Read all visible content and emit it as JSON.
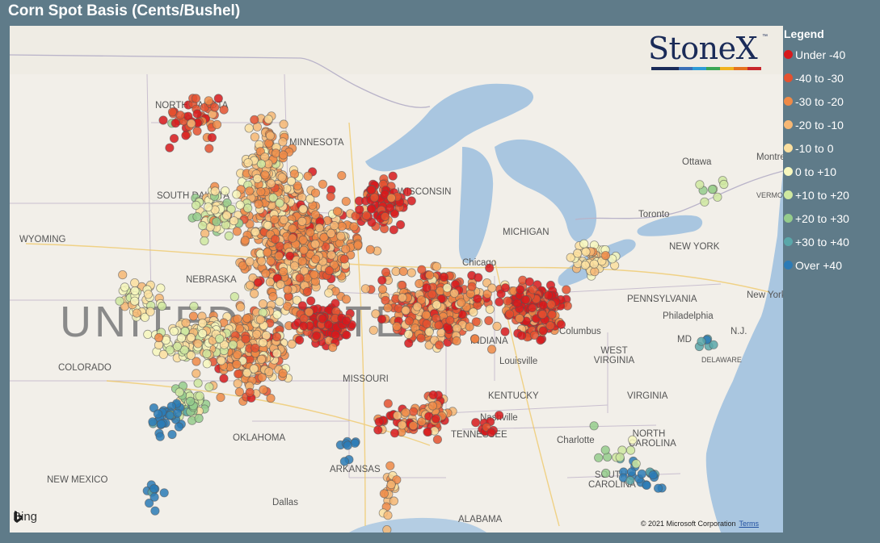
{
  "title": "Corn Spot Basis (Cents/Bushel)",
  "legend": {
    "title": "Legend",
    "items": [
      {
        "label": "Under -40",
        "color": "#d7191c"
      },
      {
        "label": "-40 to -30",
        "color": "#e4512f"
      },
      {
        "label": "-30 to -20",
        "color": "#ef8a47"
      },
      {
        "label": "-20 to -10",
        "color": "#f6b774"
      },
      {
        "label": "-10 to 0",
        "color": "#fbdf9f"
      },
      {
        "label": "0 to +10",
        "color": "#f7f7bd"
      },
      {
        "label": "+10 to +20",
        "color": "#cfe8a0"
      },
      {
        "label": "+20 to +30",
        "color": "#95cc8c"
      },
      {
        "label": "+30 to +40",
        "color": "#5aa7a9"
      },
      {
        "label": "Over +40",
        "color": "#2c7bb6"
      }
    ]
  },
  "logo": {
    "text": "StoneX",
    "tm": "™",
    "bar_colors": [
      "#1a2b58",
      "#1a2b58",
      "#3b6fb6",
      "#2e9bd6",
      "#3aa655",
      "#f0b21e",
      "#e5721f",
      "#c8262b"
    ]
  },
  "attribution": {
    "bing": "Bing",
    "copyright": "© 2021 Microsoft Corporation",
    "terms": "Terms"
  },
  "map_labels": [
    {
      "text": "NORTH DAKOTA"
    },
    {
      "text": "SOUTH DAKOTA"
    },
    {
      "text": "MINNESOTA"
    },
    {
      "text": "WISCONSIN"
    },
    {
      "text": "WYOMING"
    },
    {
      "text": "NEBRASKA"
    },
    {
      "text": "COLORADO"
    },
    {
      "text": "UNITED STATES"
    },
    {
      "text": "MICHIGAN"
    },
    {
      "text": "Chicago"
    },
    {
      "text": "MISSOURI"
    },
    {
      "text": "INDIANA"
    },
    {
      "text": "Columbus"
    },
    {
      "text": "Louisville"
    },
    {
      "text": "KENTUCKY"
    },
    {
      "text": "WEST VIRGINIA"
    },
    {
      "text": "VIRGINIA"
    },
    {
      "text": "Nashville"
    },
    {
      "text": "TENNESSEE"
    },
    {
      "text": "OKLAHOMA"
    },
    {
      "text": "ARKANSAS"
    },
    {
      "text": "NEW MEXICO"
    },
    {
      "text": "Dallas"
    },
    {
      "text": "ALABAMA"
    },
    {
      "text": "Charlotte"
    },
    {
      "text": "NORTH CAROLINA"
    },
    {
      "text": "SOUTH CAROLINA"
    },
    {
      "text": "PENNSYLVANIA"
    },
    {
      "text": "Philadelphia"
    },
    {
      "text": "NEW YORK"
    },
    {
      "text": "New York"
    },
    {
      "text": "N.J."
    },
    {
      "text": "MD"
    },
    {
      "text": "DELAWARE"
    },
    {
      "text": "Toronto"
    },
    {
      "text": "Ottawa"
    },
    {
      "text": "Montreal"
    },
    {
      "text": "VERMONT"
    }
  ]
}
